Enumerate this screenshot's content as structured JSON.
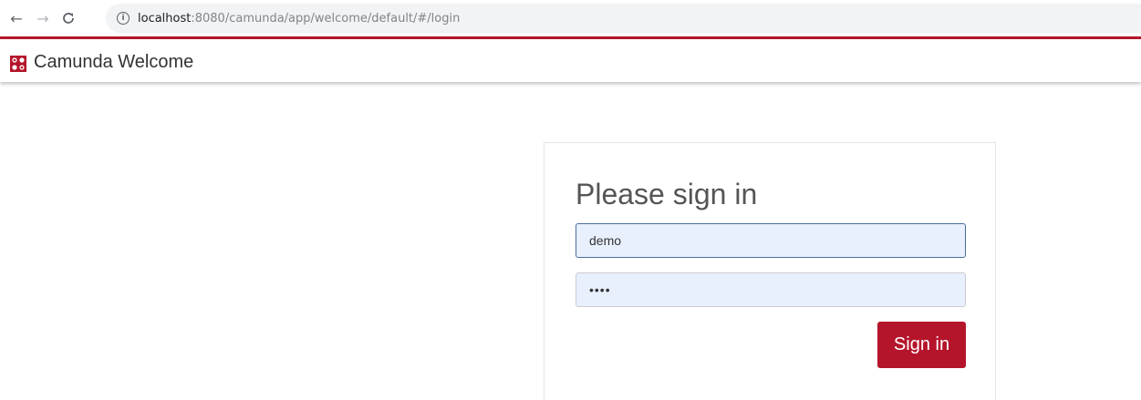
{
  "browser": {
    "back_icon": "arrow-left",
    "forward_icon": "arrow-right",
    "reload_icon": "reload",
    "info_icon": "info-circle",
    "url_host": "localhost",
    "url_rest": ":8080/camunda/app/welcome/default/#/login"
  },
  "header": {
    "title": "Camunda Welcome",
    "accent_color": "#b5152b",
    "logo_icon": "camunda-logo"
  },
  "login": {
    "title": "Please sign in",
    "username_value": "demo",
    "password_value": "demo",
    "button_label": "Sign in",
    "button_color": "#b5152b",
    "field_fill_color": "#e8f0fe"
  }
}
